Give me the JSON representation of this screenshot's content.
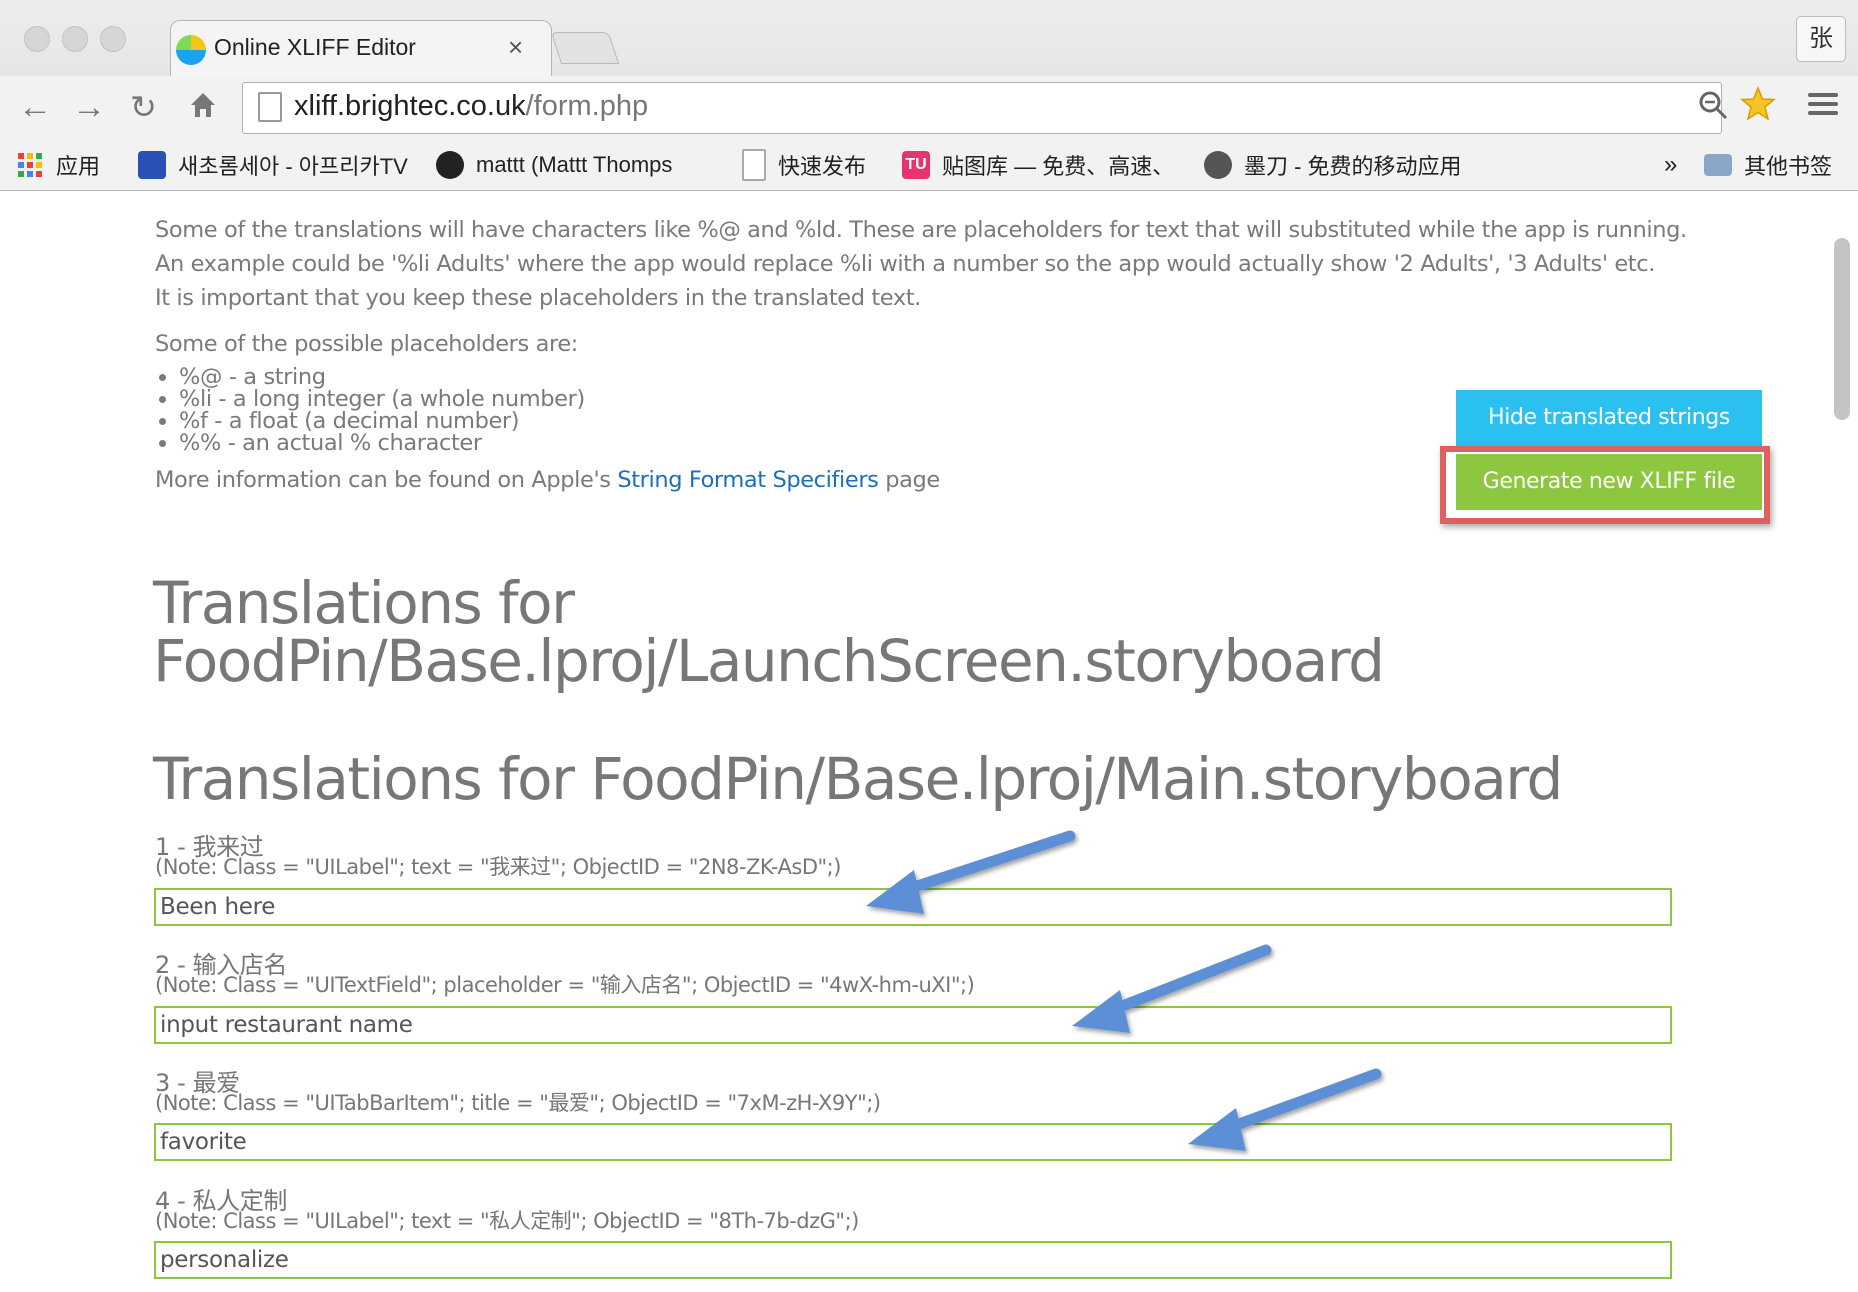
{
  "browser": {
    "tab_title": "Online XLIFF Editor",
    "tab_close": "×",
    "user_button": "张",
    "url_host": "xliff.brightec.co.uk",
    "url_path": "/form.php",
    "bookmarks": [
      {
        "label": "应用",
        "icon": "apps-grid-icon"
      },
      {
        "label": "새초롬세아 - 아프리카TV",
        "icon": "tv-icon"
      },
      {
        "label": "mattt (Mattt Thomps",
        "icon": "github-icon"
      },
      {
        "label": "快速发布",
        "icon": "page-icon"
      },
      {
        "label": "贴图库 — 免费、高速、",
        "icon": "tu-icon"
      },
      {
        "label": "墨刀 - 免费的移动应用",
        "icon": "modao-icon"
      },
      {
        "label": "»",
        "icon": "overflow-chevron"
      },
      {
        "label": "其他书签",
        "icon": "folder-icon"
      }
    ],
    "colors": {
      "tu_icon": "#e8336d",
      "tv_icon": "#2a4fb5",
      "folder": "#8aa6c8"
    }
  },
  "intro": {
    "line1": "Some of the translations will have characters like %@ and %ld. These are placeholders for text that will substituted while the app is running.",
    "line2": "An example could be '%li Adults' where the app would replace %li with a number so the app would actually show '2 Adults', '3 Adults' etc.",
    "line3": "It is important that you keep these placeholders in the translated text.",
    "possible": "Some of the possible placeholders are:",
    "placeholders": [
      "%@ - a string",
      "%li - a long integer (a whole number)",
      "%f - a float (a decimal number)",
      "%% - an actual % character"
    ],
    "more_prefix": "More information can be found on Apple's ",
    "more_link": "String Format Specifiers",
    "more_suffix": " page"
  },
  "buttons": {
    "hide_label": "Hide translated strings",
    "generate_label": "Generate new XLIFF file",
    "hide_color": "#2bc0ef",
    "generate_color": "#8dc63f",
    "highlight_color": "#e06060"
  },
  "sections": [
    {
      "title_line1": "Translations for",
      "title_line2": "FoodPin/Base.lproj/LaunchScreen.storyboard"
    },
    {
      "title": "Translations for FoodPin/Base.lproj/Main.storyboard"
    }
  ],
  "items": [
    {
      "title": "1 - 我来过",
      "note": "(Note: Class = \"UILabel\"; text = \"我来过\"; ObjectID = \"2N8-ZK-AsD\";)",
      "value": "Been here"
    },
    {
      "title": "2 - 输入店名",
      "note": "(Note: Class = \"UITextField\"; placeholder = \"输入店名\"; ObjectID = \"4wX-hm-uXI\";)",
      "value": "input restaurant name"
    },
    {
      "title": "3 - 最爱",
      "note": "(Note: Class = \"UITabBarItem\"; title = \"最爱\"; ObjectID = \"7xM-zH-X9Y\";)",
      "value": "favorite"
    },
    {
      "title": "4 - 私人定制",
      "note": "(Note: Class = \"UILabel\"; text = \"私人定制\"; ObjectID = \"8Th-7b-dzG\";)",
      "value": "personalize"
    }
  ],
  "annotation_arrow_color": "#5b8fd6"
}
